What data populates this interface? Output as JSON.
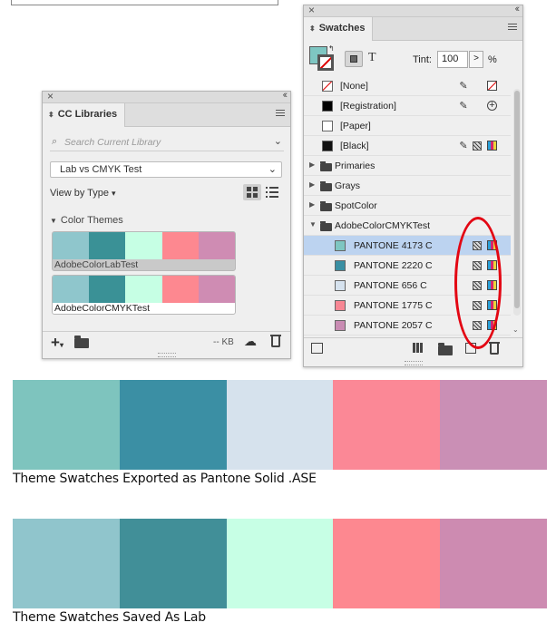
{
  "cc_libraries": {
    "panel_title": "CC Libraries",
    "search_placeholder": "Search Current Library",
    "library_select": "Lab vs CMYK Test",
    "view_by": "View by Type",
    "section_title": "Color Themes",
    "themes": [
      {
        "name": "AdobeColorLabTest",
        "colors": [
          "#8fc6cc",
          "#3a9196",
          "#c6ffe4",
          "#fd8890",
          "#cf8cb3"
        ]
      },
      {
        "name": "AdobeColorCMYKTest",
        "colors": [
          "#8fc6cc",
          "#3a9196",
          "#c6ffe4",
          "#fd8890",
          "#cf8cb3"
        ]
      }
    ],
    "storage": "-- KB"
  },
  "swatches": {
    "panel_title": "Swatches",
    "tint_label": "Tint:",
    "tint_value": "100",
    "tint_unit": "%",
    "fill_color": "#7ec6c2",
    "rows": [
      {
        "label": "[None]",
        "kind": "swatch",
        "chip": "none"
      },
      {
        "label": "[Registration]",
        "kind": "swatch",
        "chip": "#000000"
      },
      {
        "label": "[Paper]",
        "kind": "swatch",
        "chip": "#ffffff"
      },
      {
        "label": "[Black]",
        "kind": "swatch",
        "chip": "#111111"
      },
      {
        "label": "Primaries",
        "kind": "group"
      },
      {
        "label": "Grays",
        "kind": "group"
      },
      {
        "label": "SpotColor",
        "kind": "group"
      },
      {
        "label": "AdobeColorCMYKTest",
        "kind": "group-open"
      },
      {
        "label": "PANTONE 4173 C",
        "kind": "child",
        "chip": "#7ec6c2",
        "selected": true
      },
      {
        "label": "PANTONE 2220 C",
        "kind": "child",
        "chip": "#3a8fa3"
      },
      {
        "label": "PANTONE 656 C",
        "kind": "child",
        "chip": "#d6e2ee"
      },
      {
        "label": "PANTONE 1775 C",
        "kind": "child",
        "chip": "#f78794"
      },
      {
        "label": "PANTONE 2057 C",
        "kind": "child",
        "chip": "#c98cb3"
      }
    ]
  },
  "exports": [
    {
      "caption": "Theme Swatches Exported as Pantone Solid .ASE",
      "colors": [
        "#7ec4be",
        "#3b8fa4",
        "#d6e2ed",
        "#fb8896",
        "#ca8fb5"
      ]
    },
    {
      "caption": "Theme Swatches Saved As Lab",
      "colors": [
        "#90c5cc",
        "#418f98",
        "#c7ffe5",
        "#fd8890",
        "#cd8bb1"
      ]
    }
  ]
}
